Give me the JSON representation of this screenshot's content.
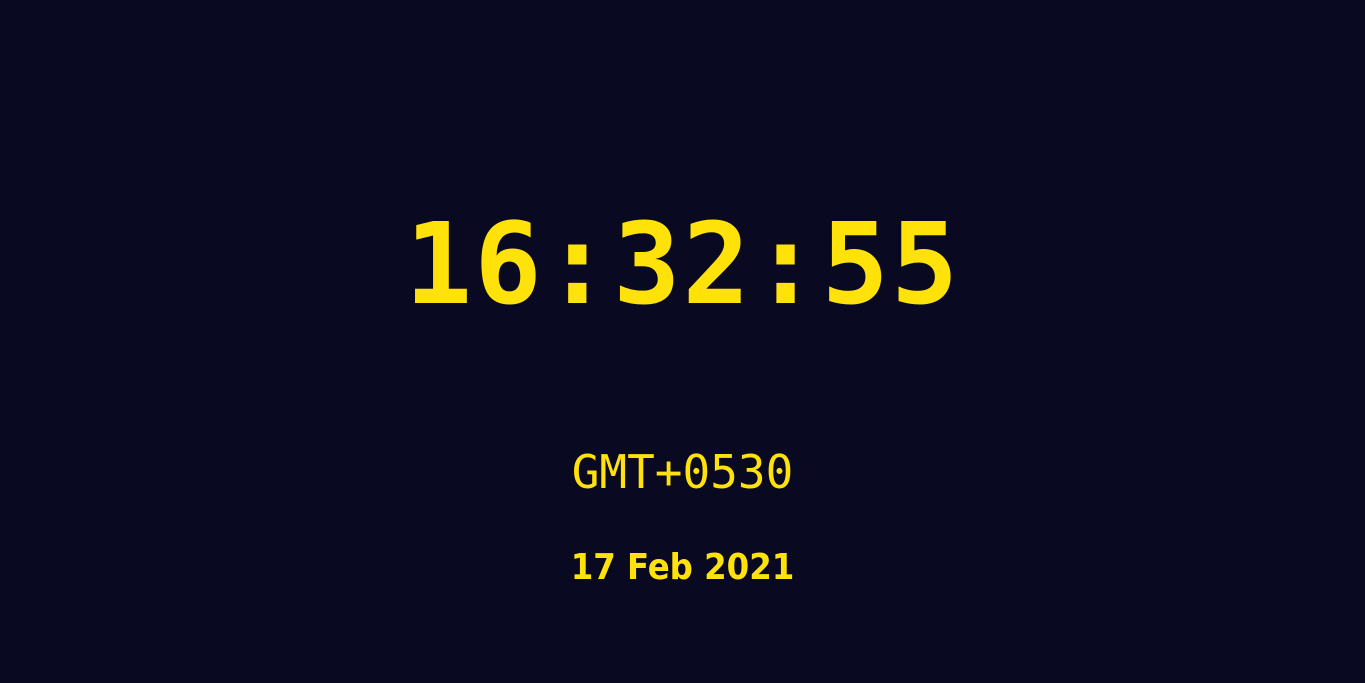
{
  "clock": {
    "time": "16:32:55",
    "timezone": "GMT+0530",
    "date": "17 Feb 2021"
  },
  "colors": {
    "background": "#090922",
    "text": "#ffe20a"
  }
}
